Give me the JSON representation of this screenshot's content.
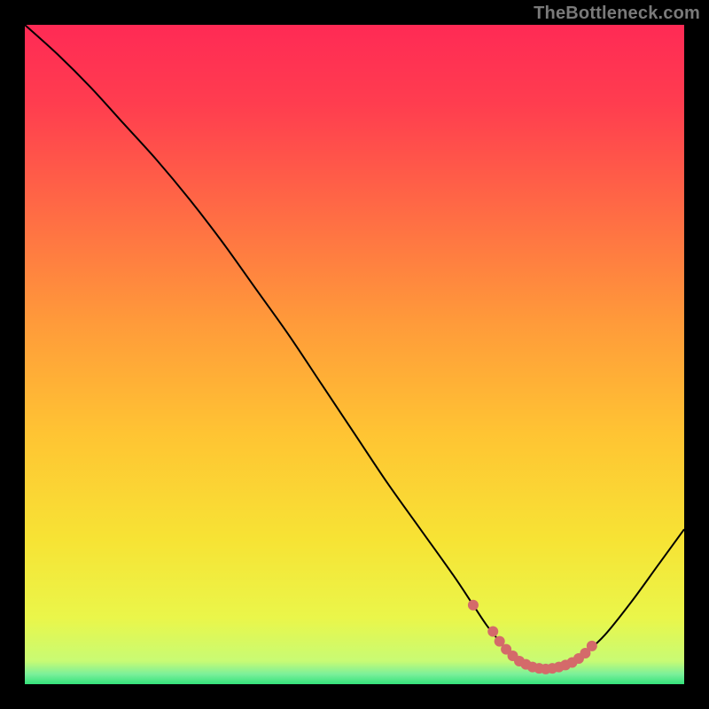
{
  "watermark": "TheBottleneck.com",
  "chart_data": {
    "type": "line",
    "title": "",
    "xlabel": "",
    "ylabel": "",
    "xlim": [
      0,
      100
    ],
    "ylim": [
      0,
      100
    ],
    "grid": false,
    "series": [
      {
        "name": "curve",
        "color": "#000000",
        "x": [
          0,
          5,
          10,
          15,
          20,
          25,
          30,
          35,
          40,
          45,
          50,
          55,
          60,
          65,
          68,
          70,
          72,
          73,
          74,
          75,
          76,
          77,
          78,
          79,
          80,
          81,
          83,
          85,
          88,
          92,
          96,
          100
        ],
        "y": [
          100,
          95.5,
          90.5,
          85,
          79.5,
          73.5,
          67,
          60,
          53,
          45.5,
          38,
          30.5,
          23.5,
          16.5,
          12,
          9,
          6.5,
          5.3,
          4.3,
          3.5,
          3,
          2.6,
          2.4,
          2.3,
          2.4,
          2.6,
          3.3,
          4.7,
          7.5,
          12.5,
          18,
          23.5
        ]
      }
    ],
    "markers": {
      "name": "highlight-dots",
      "color": "#d46a6a",
      "x": [
        68,
        71,
        72,
        73,
        74,
        75,
        76,
        77,
        78,
        79,
        80,
        81,
        82,
        83,
        84,
        85,
        86
      ],
      "y": [
        12,
        8,
        6.5,
        5.3,
        4.3,
        3.5,
        3,
        2.6,
        2.4,
        2.3,
        2.4,
        2.6,
        2.9,
        3.3,
        3.9,
        4.7,
        5.8
      ]
    },
    "gradient_stops": [
      {
        "offset": 0.0,
        "color": "#ff2a55"
      },
      {
        "offset": 0.12,
        "color": "#ff3d4f"
      },
      {
        "offset": 0.28,
        "color": "#ff6a45"
      },
      {
        "offset": 0.45,
        "color": "#ff9a3a"
      },
      {
        "offset": 0.62,
        "color": "#ffc433"
      },
      {
        "offset": 0.78,
        "color": "#f7e334"
      },
      {
        "offset": 0.9,
        "color": "#eaf64a"
      },
      {
        "offset": 0.965,
        "color": "#c8fb74"
      },
      {
        "offset": 0.985,
        "color": "#7af09a"
      },
      {
        "offset": 1.0,
        "color": "#34e27a"
      }
    ]
  }
}
